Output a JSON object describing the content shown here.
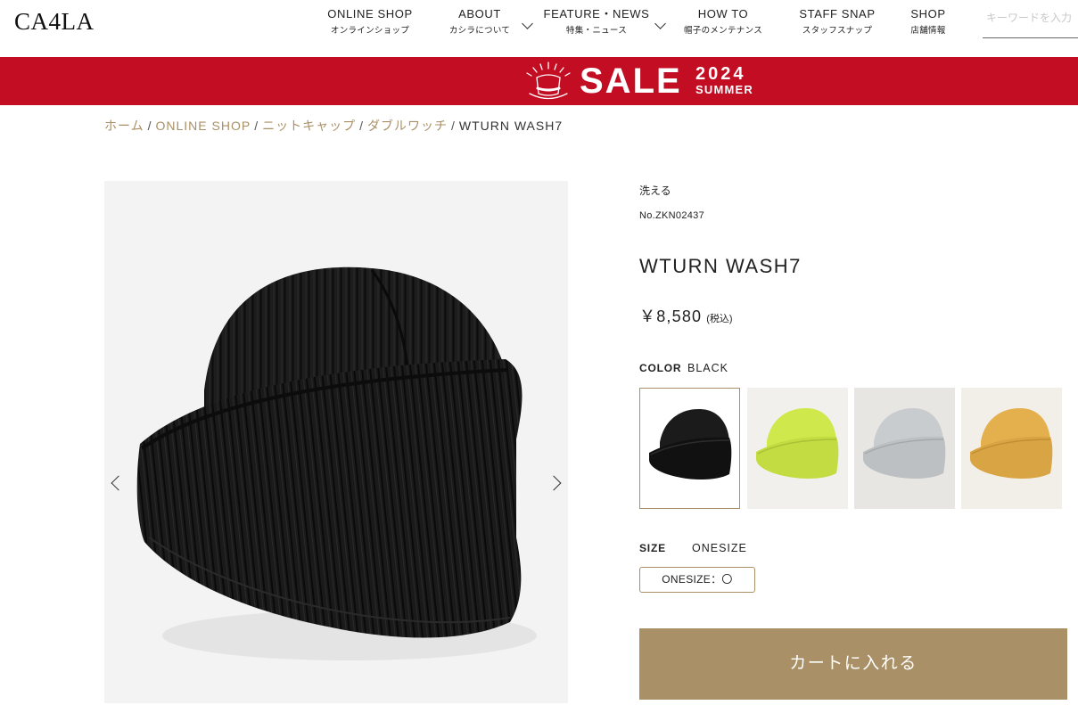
{
  "header": {
    "logo": "CA4LA",
    "nav": [
      {
        "en": "ONLINE SHOP",
        "jp": "オンラインショップ"
      },
      {
        "en": "ABOUT",
        "jp": "カシラについて"
      },
      {
        "en": "FEATURE・NEWS",
        "jp": "特集・ニュース"
      },
      {
        "en": "HOW TO",
        "jp": "帽子のメンテナンス"
      },
      {
        "en": "STAFF SNAP",
        "jp": "スタッフスナップ"
      },
      {
        "en": "SHOP",
        "jp": "店舗情報"
      }
    ],
    "search_placeholder": "キーワードを入力"
  },
  "banner": {
    "sale": "SALE",
    "year": "2024",
    "season": "SUMMER",
    "color": "#c20d23"
  },
  "breadcrumb": {
    "home": "ホーム",
    "online_shop": "ONLINE SHOP",
    "category": "ニットキャップ",
    "subcategory": "ダブルワッチ",
    "current": "WTURN WASH7",
    "separator": "/"
  },
  "product": {
    "tag": "洗える",
    "code": "No.ZKN02437",
    "name": "WTURN WASH7",
    "price": "￥8,580",
    "tax": "(税込)",
    "color_label": "COLOR",
    "color_value": "BLACK",
    "colors": [
      {
        "name": "black",
        "hex": "#1b1b1b"
      },
      {
        "name": "lime",
        "hex": "#cfe84c"
      },
      {
        "name": "light-gray",
        "hex": "#c9ccce"
      },
      {
        "name": "mustard",
        "hex": "#e4b04e"
      }
    ],
    "size_label": "SIZE",
    "size_value": "ONESIZE",
    "size_option": "ONESIZE：〇",
    "cart_button": "カートに入れる",
    "accent": "#a99066"
  }
}
